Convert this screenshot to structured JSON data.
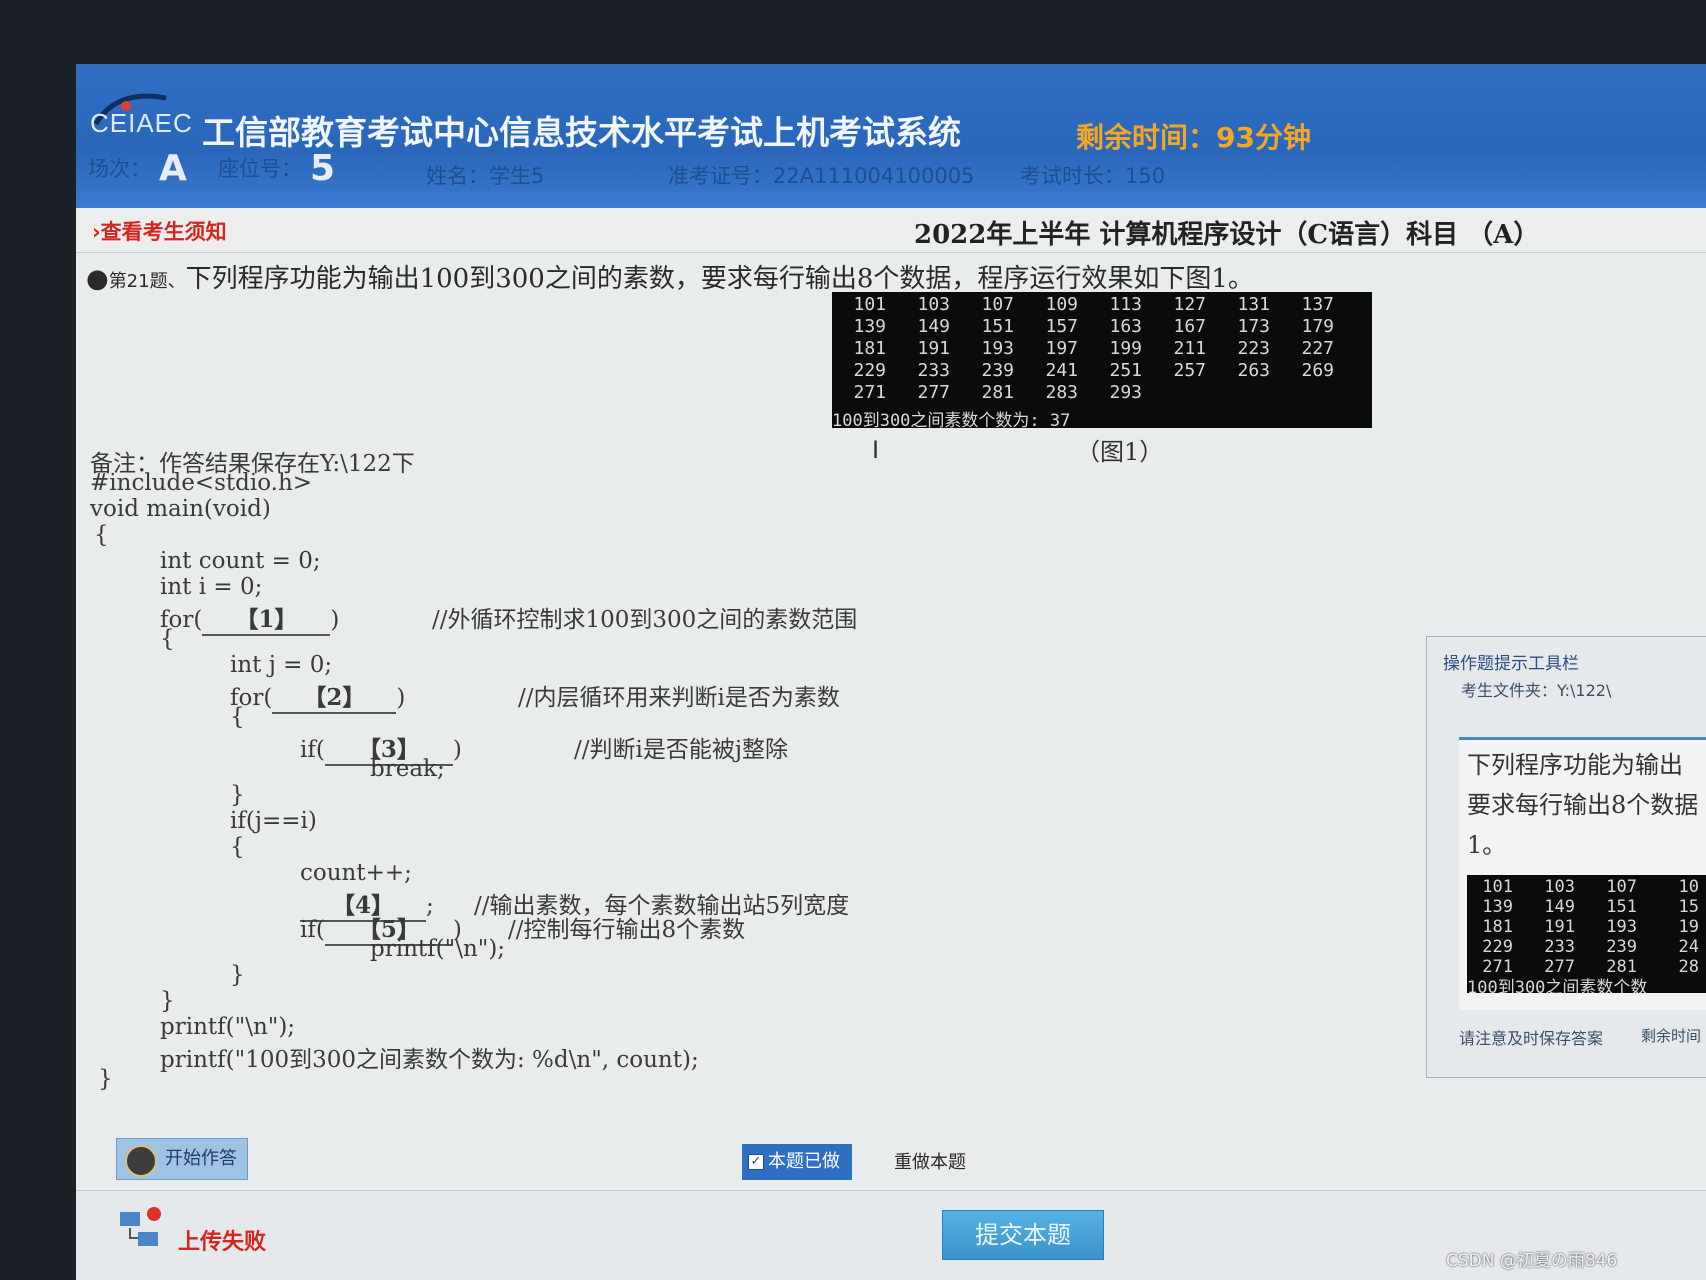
{
  "header": {
    "logo_text": "CEIAEC",
    "system_title": "工信部教育考试中心信息技术水平考试上机考试系统",
    "remaining_time": "剩余时间：93分钟",
    "session_label": "场次：",
    "session_value": "A",
    "seat_label": "座位号：",
    "seat_value": "5",
    "name": "姓名：学生5",
    "ticket": "准考证号：22A111004100005",
    "duration": "考试时长：150"
  },
  "notice_bar": {
    "notice_link": "›查看考生须知",
    "subject": "2022年上半年 计算机程序设计（C语言）科目 （A）"
  },
  "question": {
    "bullet": "●",
    "number": "第21题、",
    "text": "下列程序功能为输出100到300之间的素数，要求每行输出8个数据，程序运行效果如下图1。",
    "figure_caption": "（图1）",
    "console_rows": [
      [
        "101",
        "103",
        "107",
        "109",
        "113",
        "127",
        "131",
        "137"
      ],
      [
        "139",
        "149",
        "151",
        "157",
        "163",
        "167",
        "173",
        "179"
      ],
      [
        "181",
        "191",
        "193",
        "197",
        "199",
        "211",
        "223",
        "227"
      ],
      [
        "229",
        "233",
        "239",
        "241",
        "251",
        "257",
        "263",
        "269"
      ],
      [
        "271",
        "277",
        "281",
        "283",
        "293",
        "",
        "",
        ""
      ]
    ],
    "console_summary": "100到300之间素数个数为: 37"
  },
  "code": {
    "note": "备注：作答结果保存在Y:\\122下",
    "l1": "#include<stdio.h>",
    "l2": "void main(void)",
    "l3": "{",
    "l4": "int count = 0;",
    "l5": "int i = 0;",
    "l6_pre": "for(",
    "blank1": "【1】",
    "l6_post": ")",
    "c1": "//外循环控制求100到300之间的素数范围",
    "l7": "{",
    "l8": "int j = 0;",
    "l9_pre": "for(",
    "blank2": "【2】",
    "l9_post": ")",
    "c2": "//内层循环用来判断i是否为素数",
    "l10": "{",
    "l11_pre": "if(",
    "blank3": "【3】",
    "l11_post": ")",
    "c3": "//判断i是否能被j整除",
    "l12": "break;",
    "l13": "}",
    "l14": "if(j==i)",
    "l15": "{",
    "l16": "count++;",
    "blank4": "【4】",
    "l17_post": ";",
    "c4": "//输出素数，每个素数输出站5列宽度",
    "l18_pre": "if(",
    "blank5": "【5】",
    "l18_post": ")",
    "c5": "//控制每行输出8个素数",
    "l19": "printf(\"\\n\");",
    "l20": "}",
    "l21": "}",
    "l22": "printf(\"\\n\");",
    "l23": "printf(\"100到300之间素数个数为: %d\\n\", count);",
    "l24": "}"
  },
  "tool_window": {
    "title": "操作题提示工具栏",
    "folder": "考生文件夹：Y:\\122\\",
    "text_line1": "下列程序功能为输出",
    "text_line2": "要求每行输出8个数据",
    "text_line3": "1。",
    "console_rows": [
      [
        "101",
        "103",
        "107",
        "10"
      ],
      [
        "139",
        "149",
        "151",
        "15"
      ],
      [
        "181",
        "191",
        "193",
        "19"
      ],
      [
        "229",
        "233",
        "239",
        "24"
      ],
      [
        "271",
        "277",
        "281",
        "28"
      ]
    ],
    "console_summary": "100到300之间素数个数",
    "status": "请注意及时保存答案",
    "status2": "剩余时间"
  },
  "toolbar": {
    "start_label": "开始作答",
    "done_label": "本题已做",
    "redo_label": "重做本题",
    "upload_status": "上传失败",
    "submit_label": "提交本题"
  },
  "watermark": "CSDN @初夏の雨846"
}
